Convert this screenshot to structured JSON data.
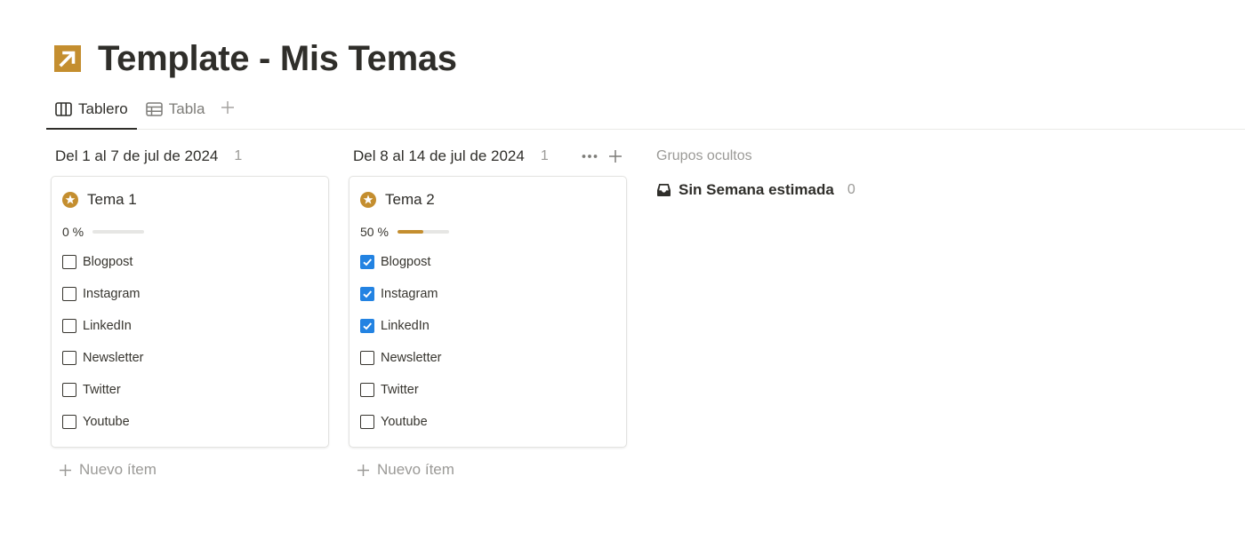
{
  "page": {
    "title": "Template - Mis Temas",
    "icon": "arrow-up-right-icon",
    "accent_color": "#c48e2f"
  },
  "tabs": [
    {
      "label": "Tablero",
      "icon": "board-icon",
      "active": true
    },
    {
      "label": "Tabla",
      "icon": "table-icon",
      "active": false
    }
  ],
  "columns": [
    {
      "title": "Del 1 al 7 de jul de 2024",
      "count": "1",
      "new_item_label": "Nuevo ítem",
      "card": {
        "title": "Tema 1",
        "progress_label": "0 %",
        "progress": 0,
        "checklist": [
          {
            "label": "Blogpost",
            "checked": false
          },
          {
            "label": "Instagram",
            "checked": false
          },
          {
            "label": "LinkedIn",
            "checked": false
          },
          {
            "label": "Newsletter",
            "checked": false
          },
          {
            "label": "Twitter",
            "checked": false
          },
          {
            "label": "Youtube",
            "checked": false
          }
        ]
      }
    },
    {
      "title": "Del 8 al 14 de jul de 2024",
      "count": "1",
      "new_item_label": "Nuevo ítem",
      "card": {
        "title": "Tema 2",
        "progress_label": "50 %",
        "progress": 0.5,
        "checklist": [
          {
            "label": "Blogpost",
            "checked": true
          },
          {
            "label": "Instagram",
            "checked": true
          },
          {
            "label": "LinkedIn",
            "checked": true
          },
          {
            "label": "Newsletter",
            "checked": false
          },
          {
            "label": "Twitter",
            "checked": false
          },
          {
            "label": "Youtube",
            "checked": false
          }
        ]
      }
    }
  ],
  "hidden_groups": {
    "title": "Grupos ocultos",
    "items": [
      {
        "label": "Sin Semana estimada",
        "count": "0",
        "icon": "inbox-icon"
      }
    ]
  },
  "colors": {
    "checked": "#2383e2",
    "text": "#37352f",
    "muted": "#9b9a97"
  }
}
